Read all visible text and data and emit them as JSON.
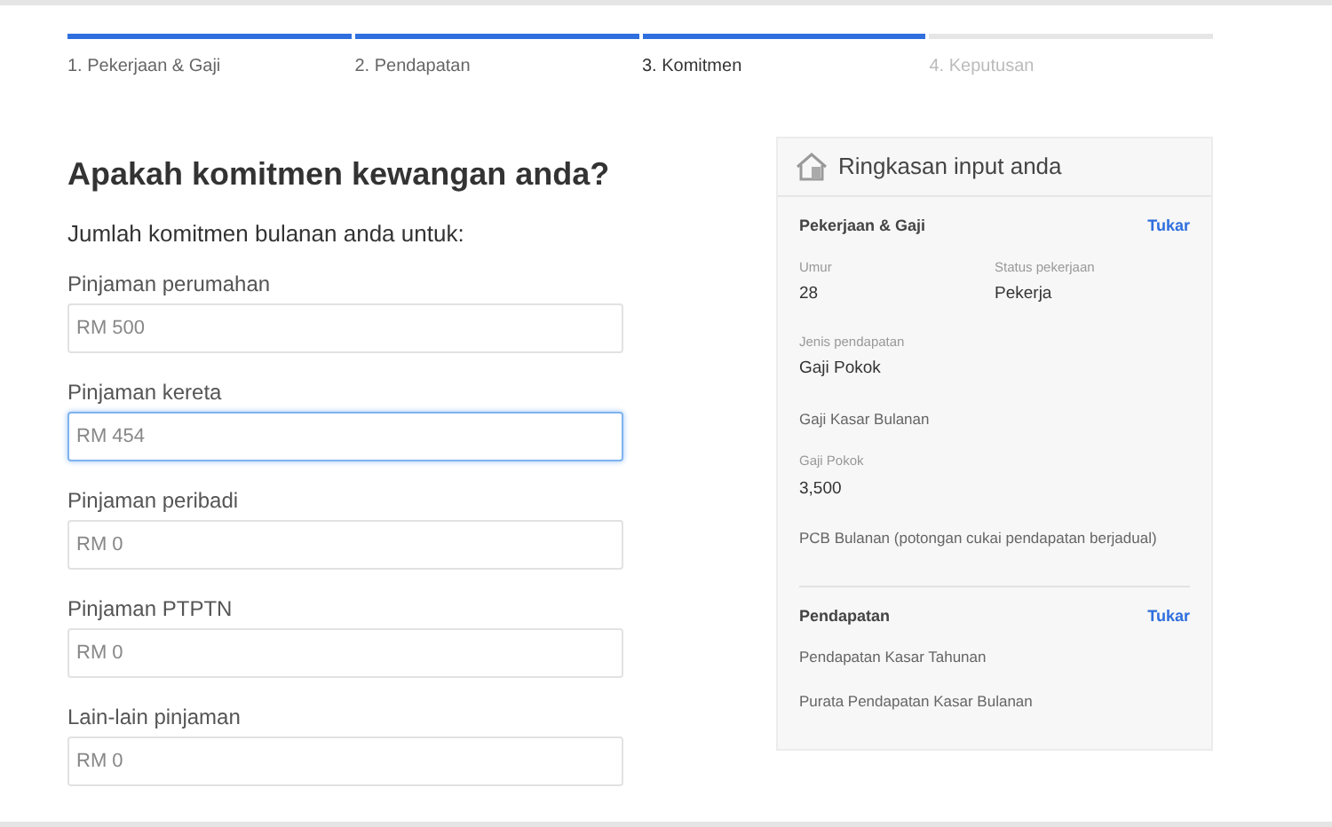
{
  "steps": [
    {
      "label": "1. Pekerjaan & Gaji",
      "completed": true,
      "selected": false
    },
    {
      "label": "2. Pendapatan",
      "completed": true,
      "selected": false
    },
    {
      "label": "3. Komitmen",
      "completed": true,
      "selected": true
    },
    {
      "label": "4. Keputusan",
      "completed": false,
      "selected": false
    }
  ],
  "form": {
    "title": "Apakah komitmen kewangan anda?",
    "subtitle": "Jumlah komitmen bulanan anda untuk:",
    "fields": [
      {
        "label": "Pinjaman perumahan",
        "placeholder": "RM 500",
        "focused": false
      },
      {
        "label": "Pinjaman kereta",
        "placeholder": "RM 454",
        "focused": true
      },
      {
        "label": "Pinjaman peribadi",
        "placeholder": "RM 0",
        "focused": false
      },
      {
        "label": "Pinjaman PTPTN",
        "placeholder": "RM 0",
        "focused": false
      },
      {
        "label": "Lain-lain pinjaman",
        "placeholder": "RM 0",
        "focused": false
      }
    ]
  },
  "summary": {
    "title": "Ringkasan input anda",
    "sections": [
      {
        "title": "Pekerjaan & Gaji",
        "action": "Tukar",
        "items": [
          {
            "kind": "pair",
            "cells": [
              {
                "label": "Umur",
                "value": "28"
              },
              {
                "label": "Status pekerjaan",
                "value": "Pekerja"
              }
            ]
          },
          {
            "kind": "field",
            "label": "Jenis pendapatan",
            "value": "Gaji Pokok"
          },
          {
            "kind": "heading",
            "text": "Gaji Kasar Bulanan"
          },
          {
            "kind": "field",
            "label": "Gaji Pokok",
            "value": "3,500"
          },
          {
            "kind": "heading",
            "text": "PCB Bulanan (potongan cukai pendapatan berjadual)"
          }
        ]
      },
      {
        "title": "Pendapatan",
        "action": "Tukar",
        "items": [
          {
            "kind": "heading",
            "text": "Pendapatan Kasar Tahunan"
          },
          {
            "kind": "heading",
            "text": "Purata Pendapatan Kasar Bulanan"
          }
        ]
      }
    ]
  }
}
